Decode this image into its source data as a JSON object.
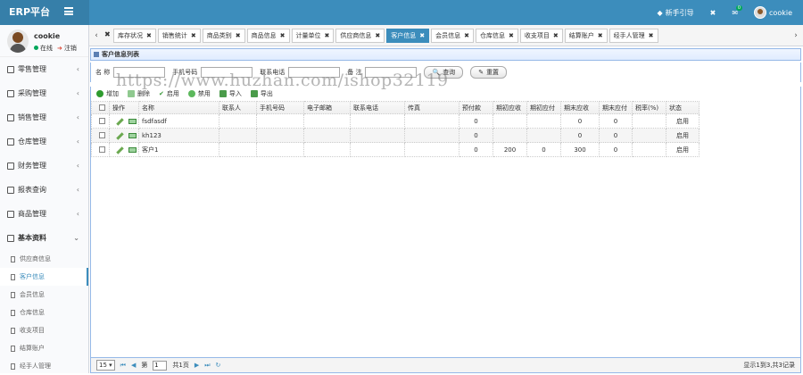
{
  "header": {
    "brand": "ERP平台",
    "guide": "新手引导",
    "notify_count": "0",
    "username": "cookie"
  },
  "user": {
    "name": "cookie",
    "status": "在线",
    "logout": "注销"
  },
  "sidebar": {
    "menus": [
      {
        "label": "零售管理"
      },
      {
        "label": "采购管理"
      },
      {
        "label": "销售管理"
      },
      {
        "label": "仓库管理"
      },
      {
        "label": "财务管理"
      },
      {
        "label": "报表查询"
      },
      {
        "label": "商品管理"
      },
      {
        "label": "基本资料"
      }
    ],
    "subitems": [
      {
        "label": "供应商信息"
      },
      {
        "label": "客户信息"
      },
      {
        "label": "会员信息"
      },
      {
        "label": "仓库信息"
      },
      {
        "label": "收支项目"
      },
      {
        "label": "结算账户"
      },
      {
        "label": "经手人管理"
      }
    ]
  },
  "tabs": [
    "库存状况",
    "销售统计",
    "商品类别",
    "商品信息",
    "计量单位",
    "供应商信息",
    "客户信息",
    "会员信息",
    "仓库信息",
    "收支项目",
    "结算账户",
    "经手人管理"
  ],
  "panel": {
    "title": "客户信息列表"
  },
  "search": {
    "name_label": "名 称",
    "phone_label": "手机号码",
    "tel_label": "联系电话",
    "remark_label": "备 注",
    "search_btn": "查询",
    "reset_btn": "重置"
  },
  "toolbar": {
    "add": "增加",
    "delete": "删除",
    "enable": "启用",
    "disable": "禁用",
    "import": "导入",
    "export": "导出"
  },
  "table": {
    "headers": [
      "操作",
      "名称",
      "联系人",
      "手机号码",
      "电子邮箱",
      "联系电话",
      "传真",
      "预付款",
      "期初应收",
      "期初应付",
      "期末应收",
      "期末应付",
      "税率(%)",
      "状态"
    ],
    "rows": [
      {
        "name": "fsdfasdf",
        "prepaid": "0",
        "init_recv": "",
        "init_pay": "",
        "end_recv": "0",
        "end_pay": "0",
        "status": "启用"
      },
      {
        "name": "kh123",
        "prepaid": "0",
        "init_recv": "",
        "init_pay": "",
        "end_recv": "0",
        "end_pay": "0",
        "status": "启用"
      },
      {
        "name": "客户1",
        "prepaid": "0",
        "init_recv": "200",
        "init_pay": "0",
        "end_recv": "300",
        "end_pay": "0",
        "status": "启用"
      }
    ]
  },
  "pager": {
    "page_size": "15",
    "page_label": "第",
    "page_value": "1",
    "total_pages": "共1页",
    "info": "显示1到3,共3记录"
  },
  "watermark": "https://www.huzhan.com/ishop32119",
  "colors": {
    "header": "#3c8dbc",
    "brand_bg": "#367fa9",
    "active_tab": "#3c8dbc"
  }
}
